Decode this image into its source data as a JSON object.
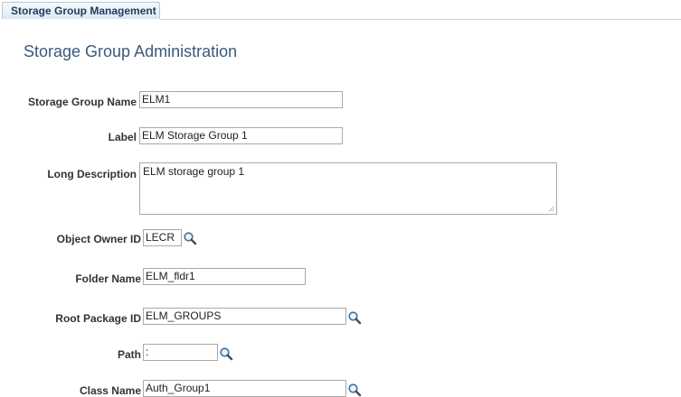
{
  "tabs": [
    {
      "label": "Storage Group Management",
      "active": true
    }
  ],
  "page": {
    "title": "Storage Group Administration"
  },
  "fields": {
    "storage_group_name": {
      "label": "Storage Group Name",
      "value": "ELM1"
    },
    "label": {
      "label": "Label",
      "value": "ELM Storage Group 1"
    },
    "long_description": {
      "label": "Long Description",
      "value": "ELM storage group 1"
    },
    "object_owner_id": {
      "label": "Object Owner ID",
      "value": "LECR",
      "lookup_icon": "search-icon"
    },
    "folder_name": {
      "label": "Folder Name",
      "value": "ELM_fldr1"
    },
    "root_package_id": {
      "label": "Root Package ID",
      "value": "ELM_GROUPS",
      "lookup_icon": "search-icon"
    },
    "path": {
      "label": "Path",
      "value": ":",
      "lookup_icon": "search-icon"
    },
    "class_name": {
      "label": "Class Name",
      "value": "Auth_Group1",
      "lookup_icon": "search-icon"
    }
  },
  "colors": {
    "title": "#3a5a7d",
    "tab_text": "#1f3c5c",
    "field_border": "#a9a9a9"
  }
}
